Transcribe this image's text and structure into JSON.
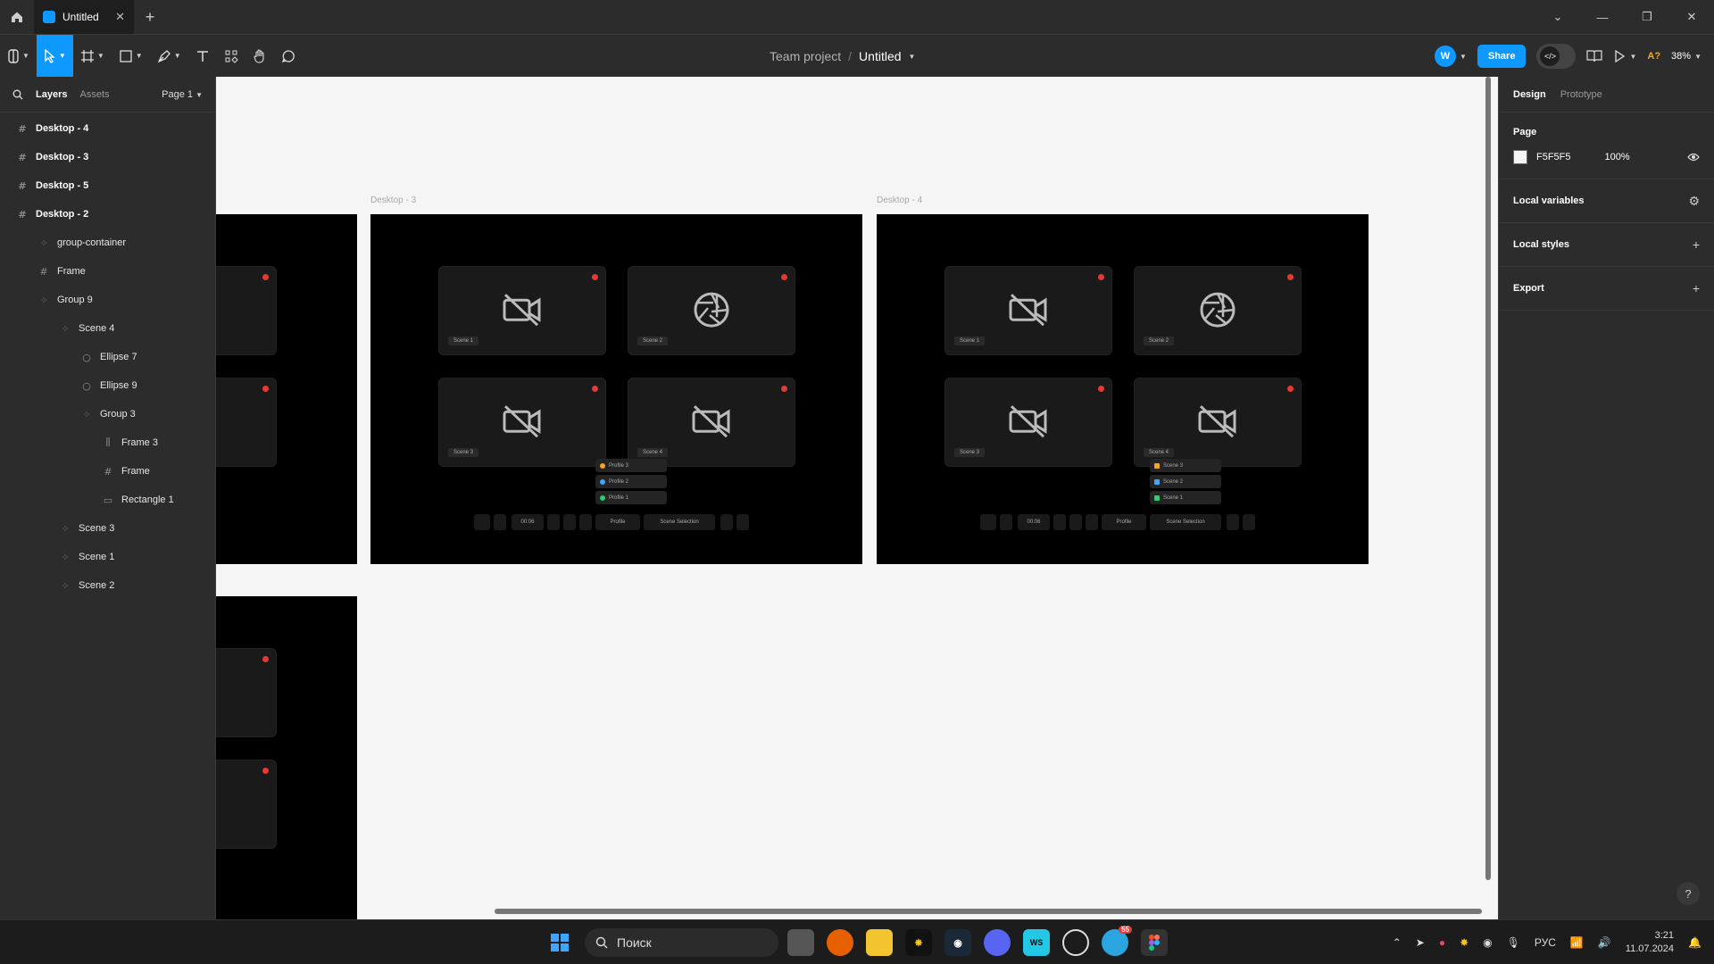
{
  "window": {
    "tab_title": "Untitled"
  },
  "toolbar": {
    "breadcrumb_team": "Team project",
    "breadcrumb_sep": "/",
    "file_name": "Untitled",
    "avatar_initial": "W",
    "share_label": "Share",
    "missing_fonts_badge": "A?",
    "zoom": "38%"
  },
  "left_panel": {
    "tabs": [
      "Layers",
      "Assets"
    ],
    "page_selector": "Page 1",
    "layers": [
      {
        "name": "Desktop - 4",
        "type": "frame",
        "depth": 0,
        "bold": true
      },
      {
        "name": "Desktop - 3",
        "type": "frame",
        "depth": 0,
        "bold": true
      },
      {
        "name": "Desktop - 5",
        "type": "frame",
        "depth": 0,
        "bold": true
      },
      {
        "name": "Desktop - 2",
        "type": "frame",
        "depth": 0,
        "bold": true
      },
      {
        "name": "group-container",
        "type": "group",
        "depth": 1,
        "bold": false
      },
      {
        "name": "Frame",
        "type": "frame",
        "depth": 1,
        "bold": false
      },
      {
        "name": "Group 9",
        "type": "group",
        "depth": 1,
        "bold": false
      },
      {
        "name": "Scene 4",
        "type": "group",
        "depth": 2,
        "bold": false
      },
      {
        "name": "Ellipse 7",
        "type": "ellipse",
        "depth": 3,
        "bold": false
      },
      {
        "name": "Ellipse 9",
        "type": "ellipse",
        "depth": 3,
        "bold": false
      },
      {
        "name": "Group 3",
        "type": "group",
        "depth": 3,
        "bold": false
      },
      {
        "name": "Frame 3",
        "type": "autolayout",
        "depth": 4,
        "bold": false
      },
      {
        "name": "Frame",
        "type": "frame",
        "depth": 4,
        "bold": false
      },
      {
        "name": "Rectangle 1",
        "type": "rectangle",
        "depth": 4,
        "bold": false
      },
      {
        "name": "Scene 3",
        "type": "group",
        "depth": 2,
        "bold": false
      },
      {
        "name": "Scene 1",
        "type": "group",
        "depth": 2,
        "bold": false
      },
      {
        "name": "Scene 2",
        "type": "group",
        "depth": 2,
        "bold": false
      }
    ]
  },
  "canvas": {
    "frames": [
      "Desktop - 3",
      "Desktop - 4"
    ],
    "scene_labels": [
      "Scene 1",
      "Scene 2",
      "Scene 3",
      "Scene 4"
    ],
    "toolbar_labels": {
      "timer": "00:06",
      "profile": "Profile",
      "scene_selection": "Scene Selection"
    },
    "profile_dropdown": [
      "Profile 3",
      "Profile 2",
      "Profile 1"
    ],
    "scene_dropdown": [
      "Scene 3",
      "Scene 2",
      "Scene 1"
    ]
  },
  "right_panel": {
    "tabs": [
      "Design",
      "Prototype"
    ],
    "page_title": "Page",
    "page_color": "F5F5F5",
    "page_opacity": "100%",
    "sections": [
      "Local variables",
      "Local styles",
      "Export"
    ],
    "help": "?"
  },
  "taskbar": {
    "search_placeholder": "Поиск",
    "notification_badge": "55",
    "language": "РУС",
    "time": "3:21",
    "date": "11.07.2024"
  },
  "colors": {
    "accent": "#0d99ff",
    "panel": "#2c2c2c",
    "canvas": "#f5f5f5",
    "record_dot": "#e53935"
  }
}
